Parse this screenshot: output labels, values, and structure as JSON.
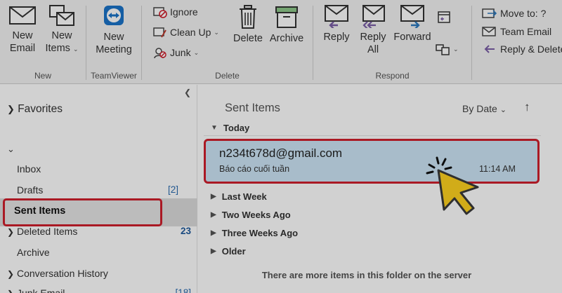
{
  "ribbon": {
    "new_group": {
      "label": "New",
      "new_email": "New Email",
      "new_items": "New Items"
    },
    "teamviewer_group": {
      "label": "TeamViewer",
      "new_meeting": "New Meeting"
    },
    "delete_group": {
      "label": "Delete",
      "ignore": "Ignore",
      "clean_up": "Clean Up",
      "junk": "Junk",
      "delete": "Delete",
      "archive": "Archive"
    },
    "respond_group": {
      "label": "Respond",
      "reply": "Reply",
      "reply_all": "Reply All",
      "forward": "Forward"
    },
    "quick_steps": {
      "move_to": "Move to: ?",
      "team_email": "Team Email",
      "reply_delete": "Reply & Delete"
    }
  },
  "sidebar": {
    "favorites": "Favorites",
    "folders": [
      {
        "label": "Inbox",
        "count": ""
      },
      {
        "label": "Drafts",
        "count": "[2]"
      },
      {
        "label": "Sent Items",
        "count": ""
      },
      {
        "label": "Deleted Items",
        "count": "23"
      },
      {
        "label": "Archive",
        "count": ""
      },
      {
        "label": "Conversation History",
        "count": ""
      },
      {
        "label": "Junk Email",
        "count": "[18]"
      }
    ]
  },
  "list": {
    "title": "Sent Items",
    "sort_label": "By Date",
    "groups": [
      "Today",
      "Last Week",
      "Two Weeks Ago",
      "Three Weeks Ago",
      "Older"
    ],
    "mail": {
      "from": "n234t678d@gmail.com",
      "subject": "Báo cáo cuối tuần",
      "time": "11:14 AM"
    },
    "server_message": "There are more items in this folder on the server"
  },
  "colors": {
    "highlight_red": "#d01f2c",
    "selected_blue": "#cde6f7",
    "cursor_yellow": "#ffd21f"
  }
}
